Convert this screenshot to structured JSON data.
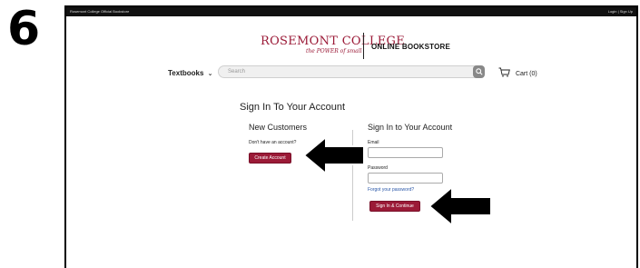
{
  "step": "6",
  "topbar": {
    "left": "Rosemont College Official Bookstore",
    "right": "Login | Sign Up"
  },
  "logo": {
    "name": "ROSEMONT COLLEGE",
    "tagline": "the POWER of small"
  },
  "store_name": "ONLINE BOOKSTORE",
  "nav": {
    "textbooks": "Textbooks",
    "search_placeholder": "Search",
    "cart": "Cart (0)"
  },
  "signin": {
    "page_title": "Sign In To Your Account",
    "new_customers": {
      "title": "New Customers",
      "text": "Don't have an account?",
      "button": "Create Account"
    },
    "existing": {
      "title": "Sign In to Your Account",
      "email_label": "Email",
      "password_label": "Password",
      "forgot": "Forgot your password?",
      "button": "Sign In & Continue"
    }
  },
  "colors": {
    "brand": "#9b1a37",
    "arrow": "#000000"
  },
  "icons": [
    "chevron-down-icon",
    "search-icon",
    "cart-icon",
    "arrow-left-icon"
  ]
}
